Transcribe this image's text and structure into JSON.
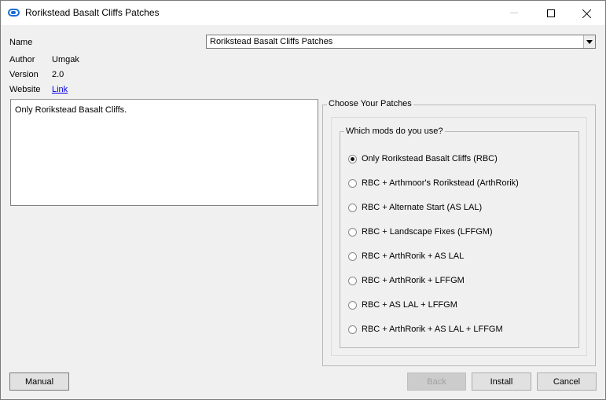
{
  "window": {
    "title": "Rorikstead Basalt Cliffs Patches",
    "app_icon": "installer-icon"
  },
  "info": {
    "name_label": "Name",
    "author_label": "Author",
    "author_value": "Umgak",
    "version_label": "Version",
    "version_value": "2.0",
    "website_label": "Website",
    "website_link": "Link"
  },
  "name_select": {
    "value": "Rorikstead Basalt Cliffs Patches"
  },
  "description": {
    "text": "Only Rorikstead Basalt Cliffs."
  },
  "patches": {
    "group_title": "Choose Your Patches",
    "inner_title": "Which mods do you use?",
    "selected_index": 0,
    "options": [
      "Only Rorikstead Basalt Cliffs (RBC)",
      "RBC + Arthmoor's Rorikstead (ArthRorik)",
      "RBC + Alternate Start (AS LAL)",
      "RBC + Landscape Fixes (LFFGM)",
      "RBC + ArthRorik + AS LAL",
      "RBC + ArthRorik + LFFGM",
      "RBC + AS LAL + LFFGM",
      "RBC + ArthRorik + AS LAL + LFFGM"
    ]
  },
  "buttons": {
    "manual": "Manual",
    "back": "Back",
    "install": "Install",
    "cancel": "Cancel"
  }
}
